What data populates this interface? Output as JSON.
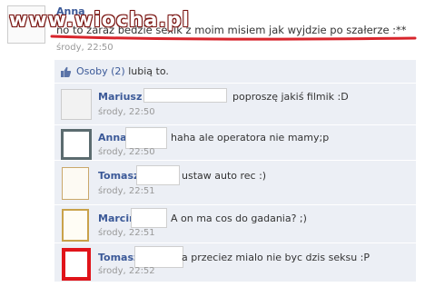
{
  "watermark": "www.wiocha.pl",
  "post": {
    "author": "Anna",
    "text": "no to zaraz bedzie sexik z moim misiem jak wyjdzie po szałerze :**",
    "time": "środy, 22:50",
    "dot": "·"
  },
  "likes": {
    "count_text": "Osoby (2)",
    "suffix": "lubią to."
  },
  "comments": [
    {
      "author": "Mariusz",
      "text": "poproszę jakiś filmik :D",
      "time": "środy, 22:50"
    },
    {
      "author": "Anna",
      "text": "haha ale operatora nie mamy;p",
      "time": "środy, 22:50"
    },
    {
      "author": "Tomasz",
      "text": "ustaw auto rec :)",
      "time": "środy, 22:51"
    },
    {
      "author": "Marcin",
      "text": "A on ma cos do gadania? ;)",
      "time": "środy, 22:51"
    },
    {
      "author": "Tomasz",
      "text": "a przeciez mialo nie byc dzis seksu :P",
      "time": "środy, 22:52"
    }
  ],
  "colors": {
    "link": "#3b5998",
    "panel": "#eceff5",
    "underline": "#d8252c",
    "watermark": "#7a1512"
  },
  "icons": [
    "thumbs-up-icon"
  ]
}
